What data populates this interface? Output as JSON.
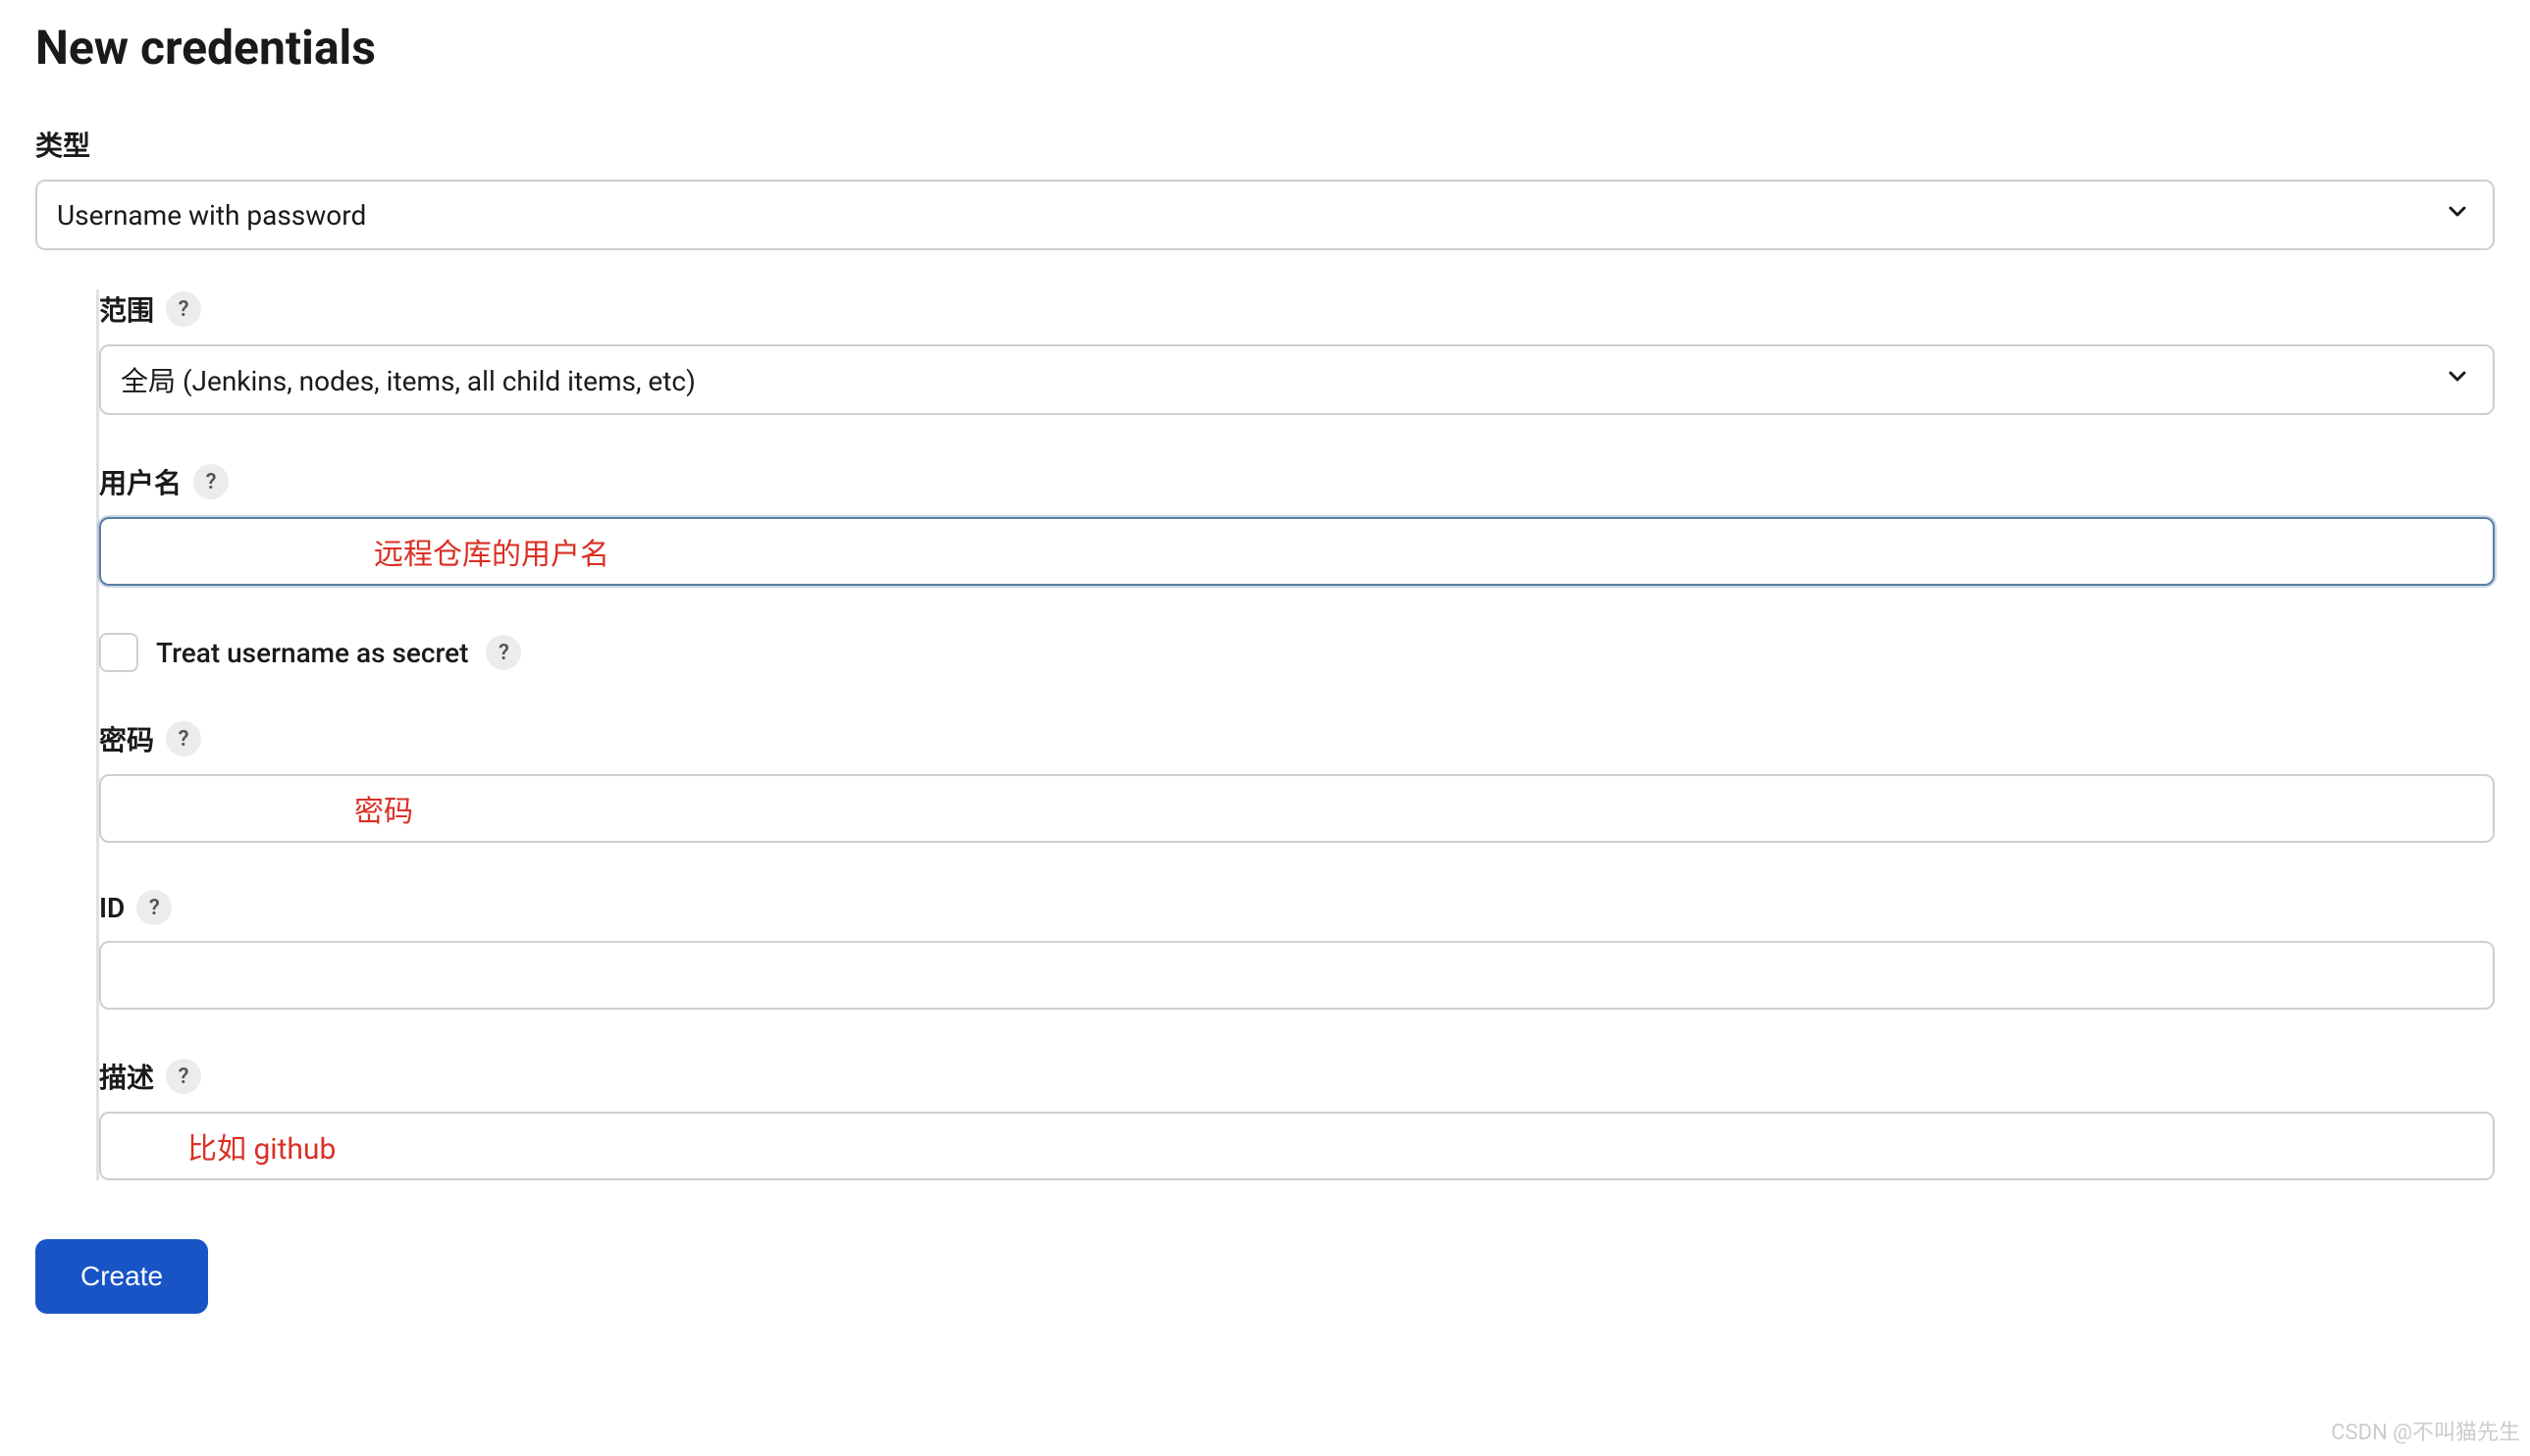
{
  "page": {
    "title": "New credentials"
  },
  "typeField": {
    "label": "类型",
    "value": "Username with password"
  },
  "scopeField": {
    "label": "范围",
    "value": "全局 (Jenkins, nodes, items, all child items, etc)"
  },
  "usernameField": {
    "label": "用户名",
    "annotation": "远程仓库的用户名",
    "value": ""
  },
  "treatAsSecret": {
    "label": "Treat username as secret",
    "checked": false
  },
  "passwordField": {
    "label": "密码",
    "annotation": "密码",
    "value": ""
  },
  "idField": {
    "label": "ID",
    "value": ""
  },
  "descriptionField": {
    "label": "描述",
    "annotation": "比如 github",
    "value": ""
  },
  "createButton": {
    "label": "Create"
  },
  "helpIcon": {
    "glyph": "?"
  },
  "watermark": "CSDN @不叫猫先生"
}
